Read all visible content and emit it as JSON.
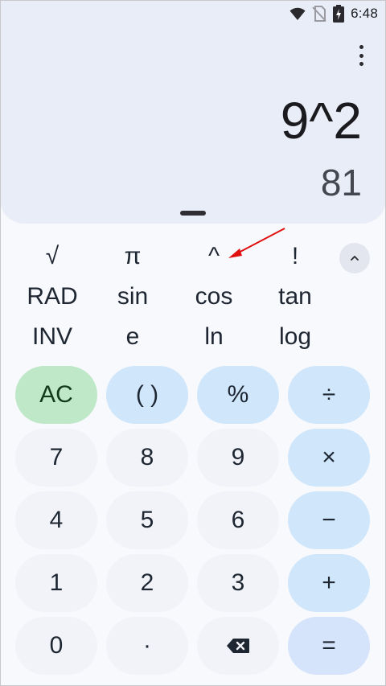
{
  "status_bar": {
    "time": "6:48",
    "icons": [
      "wifi-icon",
      "no-sim-icon",
      "battery-charging-icon"
    ]
  },
  "display": {
    "expression": "9^2",
    "result": "81",
    "menu_icon": "more-vert-icon"
  },
  "scientific": {
    "rows": [
      [
        "√",
        "π",
        "^",
        "!"
      ],
      [
        "RAD",
        "sin",
        "cos",
        "tan"
      ],
      [
        "INV",
        "e",
        "ln",
        "log"
      ]
    ],
    "collapse_icon": "chevron-up-icon"
  },
  "keypad": {
    "rows": [
      [
        "AC",
        "( )",
        "%",
        "÷"
      ],
      [
        "7",
        "8",
        "9",
        "×"
      ],
      [
        "4",
        "5",
        "6",
        "−"
      ],
      [
        "1",
        "2",
        "3",
        "+"
      ],
      [
        "0",
        "·",
        "backspace",
        "="
      ]
    ],
    "backspace_icon": "backspace-icon"
  },
  "annotation": {
    "arrow_color": "#e01010"
  },
  "colors": {
    "display_bg": "#e9edf7",
    "operator_key": "#cfe6fb",
    "clear_key": "#bfe8c8",
    "number_key": "#f1f3f8"
  }
}
